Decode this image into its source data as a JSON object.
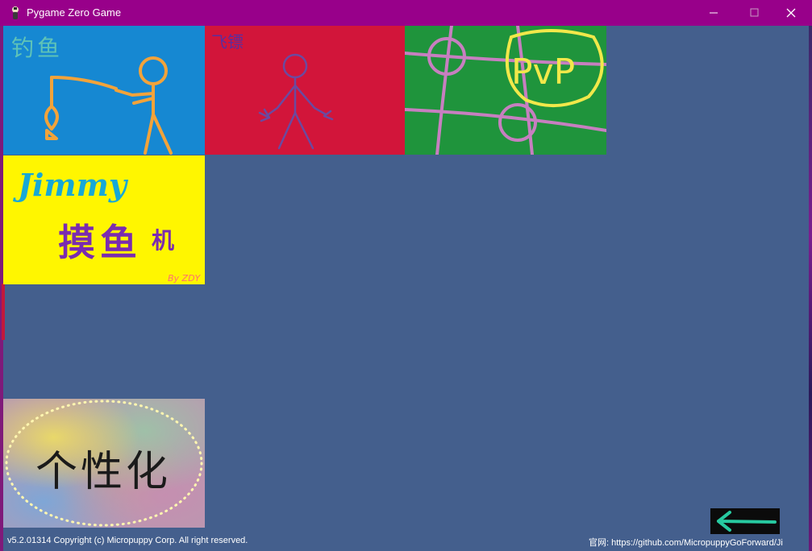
{
  "window": {
    "title": "Pygame Zero Game",
    "icons": {
      "app": "pygame-zero-icon",
      "minimize": "minimize-icon",
      "maximize": "maximize-icon",
      "close": "close-icon"
    }
  },
  "tiles": {
    "fishing": {
      "label": "钓鱼",
      "icon": "stick-figure-fishing-drawing"
    },
    "darts": {
      "label": "飞镖",
      "icon": "stick-figure-drawing"
    },
    "pvp": {
      "label": "PvP",
      "icon": "grid-pvp-drawing"
    },
    "jimmy": {
      "title": "Jimmy",
      "subtitle_main": "摸鱼",
      "subtitle_last": "机",
      "author": "By ZDY"
    },
    "custom": {
      "label": "个性化"
    }
  },
  "back_button": {
    "icon": "back-arrow-icon"
  },
  "footer": {
    "copyright": "v5.2.01314 Copyright (c) Micropuppy Corp. All right reserved.",
    "website": "官网: https://github.com/MicropuppyGoForward/Ji"
  },
  "colors": {
    "background": "#445f8d",
    "titlebar": "#98008a",
    "fishing_tile": "#1688d2",
    "darts_tile": "#d2153a",
    "pvp_tile": "#1f943c",
    "jimmy_tile": "#fff600",
    "back_arrow": "#27c9a0"
  }
}
